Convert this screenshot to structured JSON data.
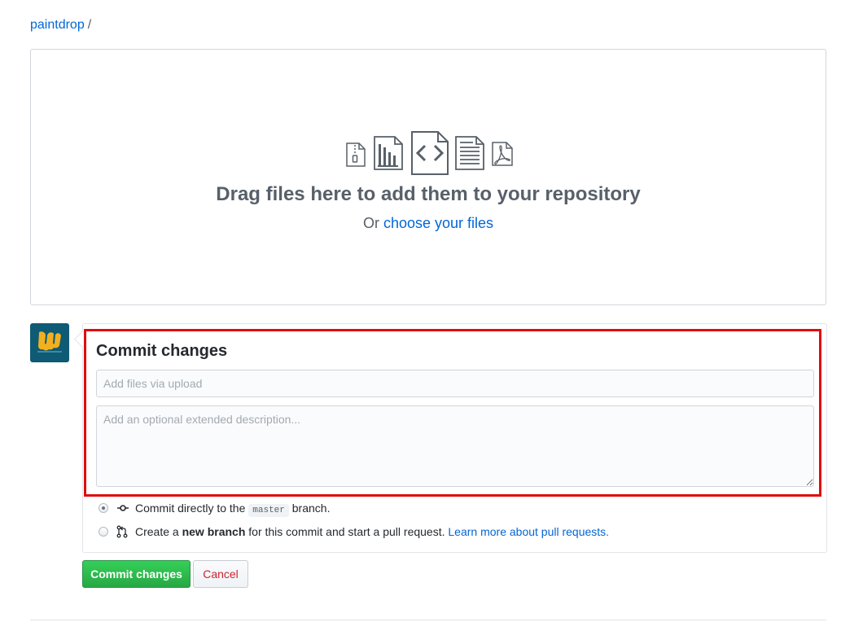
{
  "breadcrumb": {
    "repo": "paintdrop",
    "separator": "/"
  },
  "dropzone": {
    "title": "Drag files here to add them to your repository",
    "or_text": "Or",
    "choose_link": "choose your files",
    "icons": [
      "file-zip-icon",
      "file-chart-icon",
      "file-code-icon",
      "file-text-icon",
      "file-pdf-icon"
    ]
  },
  "commit": {
    "title": "Commit changes",
    "summary": {
      "value": "",
      "placeholder": "Add files via upload"
    },
    "description": {
      "value": "",
      "placeholder": "Add an optional extended description..."
    },
    "options": [
      {
        "selected": true,
        "text_before": "Commit directly to the",
        "branch": "master",
        "text_after": "branch."
      },
      {
        "selected": false,
        "text_before": "Create a",
        "bold": "new branch",
        "text_after": "for this commit and start a pull request.",
        "link": "Learn more about pull requests."
      }
    ]
  },
  "buttons": {
    "commit": "Commit changes",
    "cancel": "Cancel"
  },
  "colors": {
    "accent": "#0366d6",
    "commit_button": "#28a745",
    "highlight": "#e00d0d",
    "cancel_text": "#cb2431"
  }
}
